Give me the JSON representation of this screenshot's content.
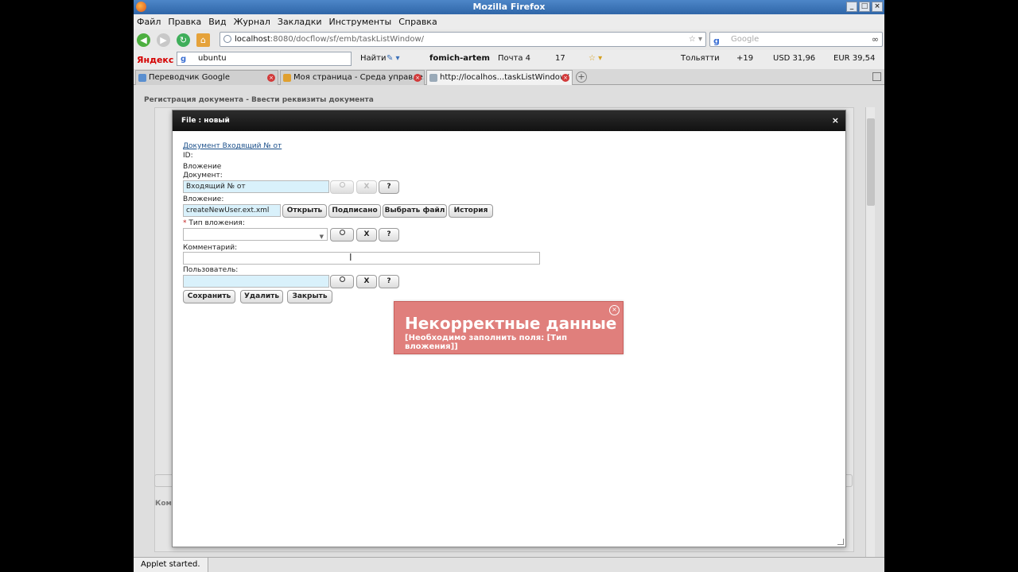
{
  "window": {
    "title": "Mozilla Firefox"
  },
  "menu": [
    "Файл",
    "Правка",
    "Вид",
    "Журнал",
    "Закладки",
    "Инструменты",
    "Справка"
  ],
  "nav": {
    "url_host": "localhost",
    "url_rest": ":8080/docflow/sf/emb/taskListWindow/",
    "url_end": "☆ ▾",
    "search_placeholder": "Google",
    "search_engine_glyph": "g"
  },
  "yandex": {
    "brand": "Яндекс",
    "query": "ubuntu",
    "find": "Найти",
    "user": "fomich-artem",
    "mail": "Почта 4",
    "rss": "17",
    "city": "Тольятти",
    "weather": "+19",
    "usd": "USD 31,96",
    "eur": "EUR 39,54"
  },
  "tabs": [
    {
      "label": "Переводчик Google",
      "active": false
    },
    {
      "label": "Моя страница - Среда управле...",
      "active": false
    },
    {
      "label": "http://localhos...taskListWindow/",
      "active": true
    }
  ],
  "page": {
    "bg_title": "Регистрация документа - Ввести реквизиты документа",
    "bg_comment_label": "Комм"
  },
  "dialog": {
    "title": "File : новый",
    "close": "×",
    "doc_link": "Документ Входящий № от",
    "id_label": "ID:",
    "attachment_section": "Вложение",
    "document_label": "Документ:",
    "document_value": "Входящий №  от",
    "attachment_label": "Вложение:",
    "attachment_value": "createNewUser.ext.xml",
    "type_label": "Тип вложения:",
    "type_required_mark": "*",
    "type_value": "",
    "comment_label": "Комментарий:",
    "comment_value": "",
    "user_label": "Пользователь:",
    "user_value": "",
    "btn_open": "Открыть",
    "btn_signed": "Подписано",
    "btn_choose": "Выбрать файл",
    "btn_history": "История",
    "btn_clear": "X",
    "btn_help": "?",
    "btn_save": "Сохранить",
    "btn_delete": "Удалить",
    "btn_close": "Закрыть"
  },
  "toast": {
    "title": "Некорректные данные",
    "message": "[Необходимо заполнить поля: [Тип вложения]]",
    "color": "#e07f7c"
  },
  "status": {
    "text": "Applet started."
  }
}
